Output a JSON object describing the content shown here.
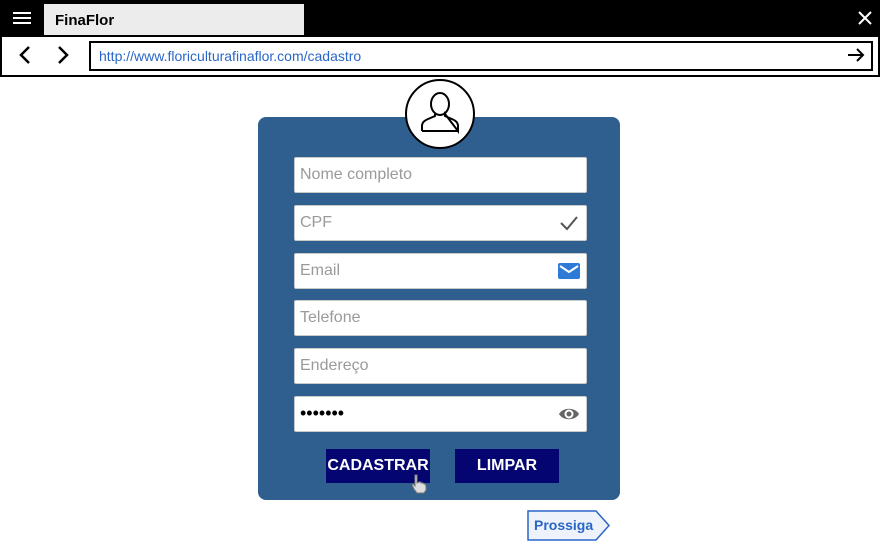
{
  "browser": {
    "tab_title": "FinaFlor",
    "url": "http://www.floriculturafinaflor.com/cadastro"
  },
  "form": {
    "fields": [
      {
        "name": "nome",
        "placeholder": "Nome completo",
        "icon": null
      },
      {
        "name": "cpf",
        "placeholder": "CPF",
        "icon": "checkmark-icon"
      },
      {
        "name": "email",
        "placeholder": "Email",
        "icon": "envelope-icon"
      },
      {
        "name": "telefone",
        "placeholder": "Telefone",
        "icon": null
      },
      {
        "name": "endereco",
        "placeholder": "Endereço",
        "icon": null
      },
      {
        "name": "senha",
        "value": "•••••••",
        "icon": "eye-icon"
      }
    ],
    "register_label": "CADASTRAR",
    "clear_label": "LIMPAR"
  },
  "proceed_label": "Prossiga",
  "colors": {
    "panel": "#2f5f8f",
    "button": "#050572",
    "url_text": "#2a66c9",
    "email_icon": "#2d7bd6"
  }
}
